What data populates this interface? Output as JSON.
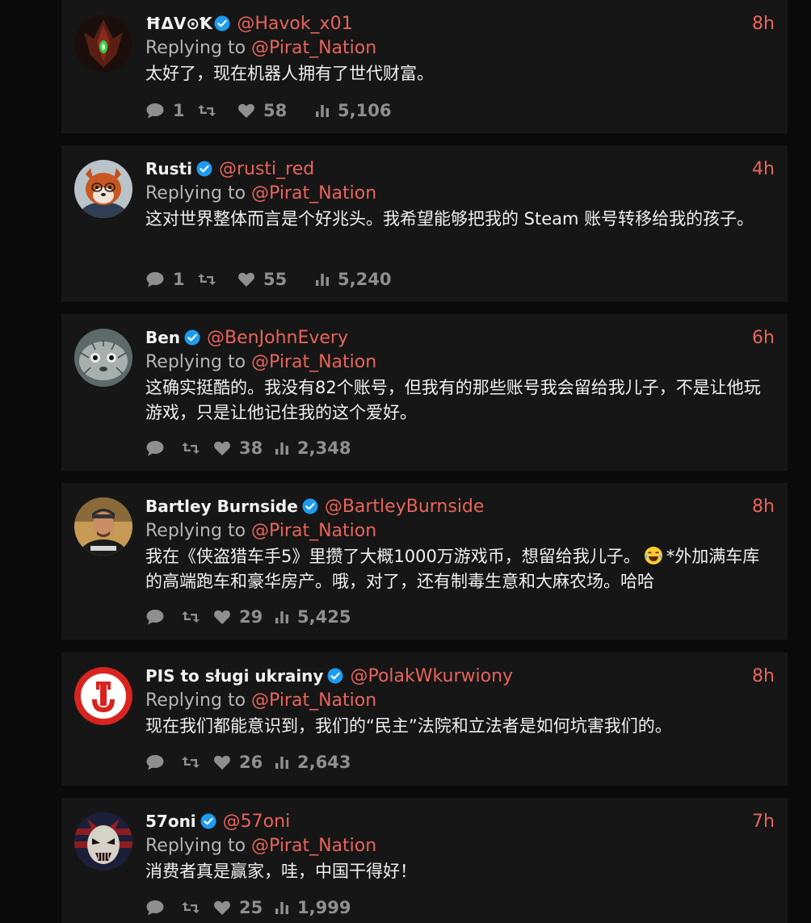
{
  "replies": [
    {
      "name": "ĦΔV⊙Ꝁ",
      "handle": "@Havok_x01",
      "time": "8h",
      "replying_prefix": "Replying to",
      "replying_to": "@Pirat_Nation",
      "text": "太好了，现在机器人拥有了世代财富。",
      "comments": "1",
      "likes": "58",
      "views": "5,106"
    },
    {
      "name": "Rusti",
      "handle": "@rusti_red",
      "time": "4h",
      "replying_prefix": "Replying to",
      "replying_to": "@Pirat_Nation",
      "text": "这对世界整体而言是个好兆头。我希望能够把我的 Steam 账号转移给我的孩子。",
      "comments": "1",
      "likes": "55",
      "views": "5,240"
    },
    {
      "name": "Ben",
      "handle": "@BenJohnEvery",
      "time": "6h",
      "replying_prefix": "Replying to",
      "replying_to": "@Pirat_Nation",
      "text": "这确实挺酷的。我没有82个账号，但我有的那些账号我会留给我儿子，不是让他玩游戏，只是让他记住我的这个爱好。",
      "comments": "",
      "likes": "38",
      "views": "2,348"
    },
    {
      "name": "Bartley Burnside",
      "handle": "@BartleyBurnside",
      "time": "8h",
      "replying_prefix": "Replying to",
      "replying_to": "@Pirat_Nation",
      "text_before_emoji": "我在《侠盗猎车手5》里攒了大概1000万游戏币，想留给我儿子。",
      "emoji": "laughing-tears-emoji",
      "text_after_emoji": "*外加满车库的高端跑车和豪华房产。哦，对了，还有制毒生意和大麻农场。哈哈",
      "comments": "",
      "likes": "29",
      "views": "5,425"
    },
    {
      "name": "PIS to sługi ukrainy",
      "handle": "@PolakWkurwiony",
      "time": "8h",
      "replying_prefix": "Replying to",
      "replying_to": "@Pirat_Nation",
      "text": "现在我们都能意识到，我们的“民主”法院和立法者是如何坑害我们的。",
      "comments": "",
      "likes": "26",
      "views": "2,643"
    },
    {
      "name": "57oni",
      "handle": "@57oni",
      "time": "7h",
      "replying_prefix": "Replying to",
      "replying_to": "@Pirat_Nation",
      "text": "消费者真是赢家，哇，中国干得好！",
      "comments": "",
      "likes": "25",
      "views": "1,999"
    }
  ],
  "colors": {
    "background": "#0a0a0a",
    "card": "#161616",
    "accent": "#e8645a",
    "verified": "#1d9bf0",
    "muted": "#8f8f8f"
  },
  "icons": {
    "comment": "comment-icon",
    "retweet": "retweet-icon",
    "like": "heart-icon",
    "views": "views-chart-icon",
    "verified": "verified-badge-icon"
  }
}
